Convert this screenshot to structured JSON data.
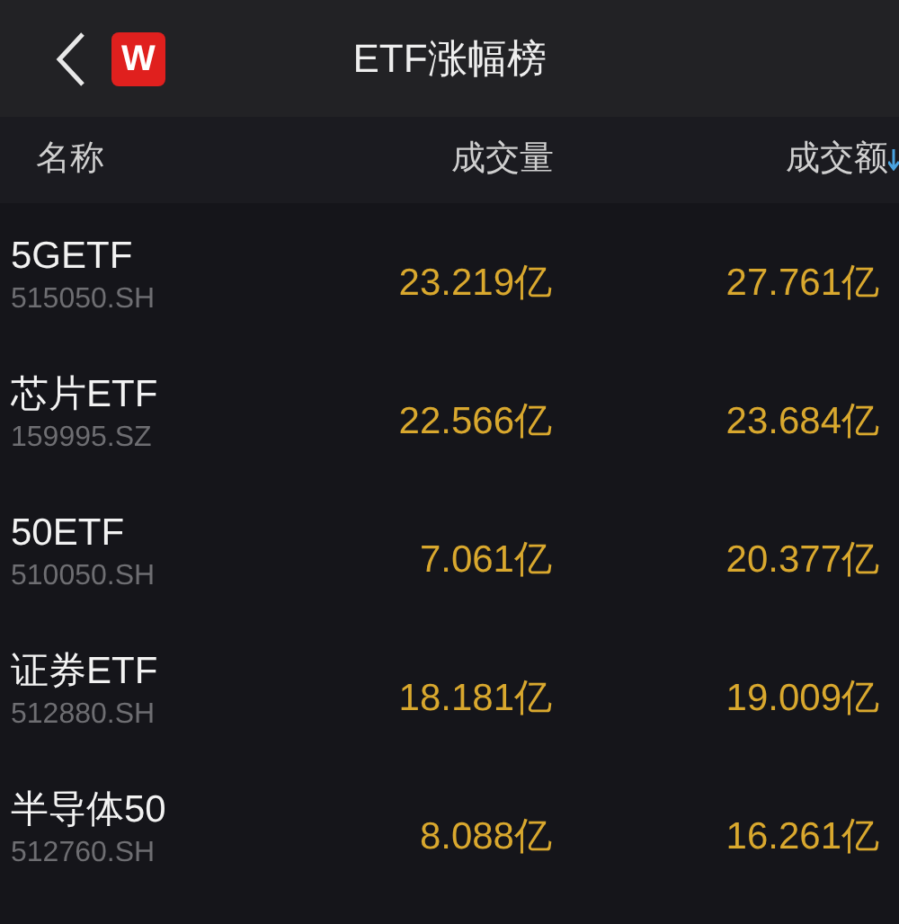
{
  "header": {
    "title": "ETF涨幅榜",
    "logo": "W"
  },
  "table": {
    "columns": [
      "名称",
      "成交量",
      "成交额"
    ],
    "rows": [
      {
        "name": "5GETF",
        "code": "515050.SH",
        "volume": "23.219亿",
        "amount": "27.761亿"
      },
      {
        "name": "芯片ETF",
        "code": "159995.SZ",
        "volume": "22.566亿",
        "amount": "23.684亿"
      },
      {
        "name": "50ETF",
        "code": "510050.SH",
        "volume": "7.061亿",
        "amount": "20.377亿"
      },
      {
        "name": "证券ETF",
        "code": "512880.SH",
        "volume": "18.181亿",
        "amount": "19.009亿"
      },
      {
        "name": "半导体50",
        "code": "512760.SH",
        "volume": "8.088亿",
        "amount": "16.261亿"
      }
    ]
  }
}
